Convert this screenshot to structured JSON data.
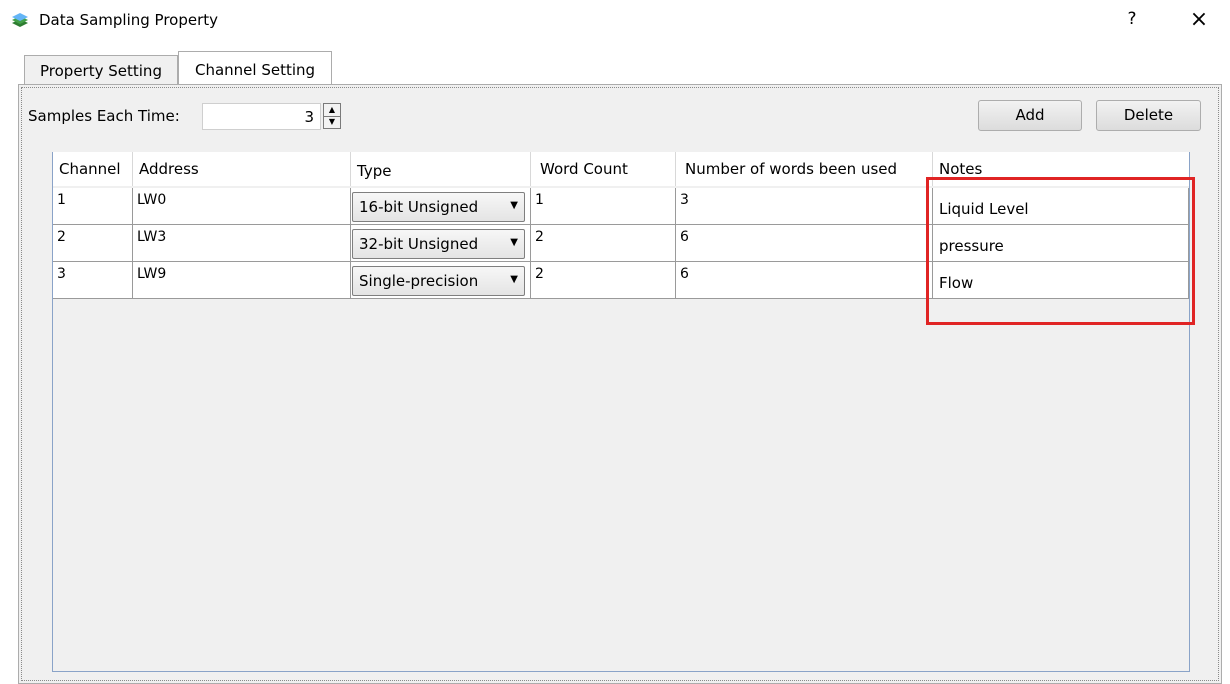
{
  "window": {
    "title": "Data Sampling Property",
    "help": "?",
    "close": "×"
  },
  "tabs": [
    {
      "label": "Property Setting"
    },
    {
      "label": "Channel Setting"
    }
  ],
  "samples": {
    "label": "Samples Each Time:",
    "value": "3"
  },
  "buttons": {
    "add": "Add",
    "delete": "Delete"
  },
  "table": {
    "headers": [
      "Channel",
      "Address",
      "Type",
      "Word Count",
      "Number of words been used",
      "Notes"
    ],
    "rows": [
      {
        "channel": "1",
        "address": "LW0",
        "type": "16-bit Unsigned",
        "word_count": "1",
        "words_used": "3",
        "notes": "Liquid Level"
      },
      {
        "channel": "2",
        "address": "LW3",
        "type": "32-bit Unsigned",
        "word_count": "2",
        "words_used": "6",
        "notes": "pressure"
      },
      {
        "channel": "3",
        "address": "LW9",
        "type": "Single-precision",
        "word_count": "2",
        "words_used": "6",
        "notes": "Flow"
      }
    ]
  },
  "colors": {
    "highlight": "#e02424",
    "tab_active": "#ffffff",
    "panel_bg": "#f0f0f0"
  },
  "icons": {
    "app": "data-sampling-app-icon",
    "dropdown": "chevron-down-icon"
  }
}
